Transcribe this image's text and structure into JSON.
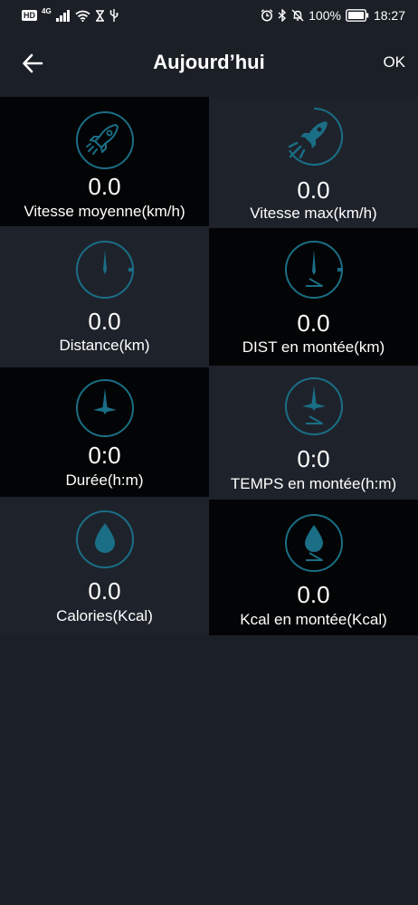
{
  "status_bar": {
    "left_icons": [
      "hd-icon",
      "signal-4g-icon",
      "wifi-icon",
      "hourglass-icon",
      "usb-icon"
    ],
    "hd_label": "HD",
    "network_label": "4G",
    "right_icons": [
      "alarm-icon",
      "bluetooth-icon",
      "bell-off-icon",
      "battery-icon"
    ],
    "battery": "100%",
    "time": "18:27"
  },
  "header": {
    "title": "Aujourd’hui",
    "ok_label": "OK",
    "back_icon": "arrow-left-icon"
  },
  "colors": {
    "background": "#1b2027",
    "tile_dark": "#030405",
    "tile_light": "#1e232b",
    "icon_accent": "#1a6e86"
  },
  "stats": [
    {
      "value": "0.0",
      "label": "Vitesse moyenne(km/h)",
      "icon": "rocket-icon"
    },
    {
      "value": "0.0",
      "label": "Vitesse max(km/h)",
      "icon": "rocket-fast-icon"
    },
    {
      "value": "0.0",
      "label": "Distance(km)",
      "icon": "distance-dial-icon"
    },
    {
      "value": "0.0",
      "label": "DIST en montée(km)",
      "icon": "distance-climb-icon"
    },
    {
      "value": "0:0",
      "label": "Durée(h:m)",
      "icon": "clock-icon"
    },
    {
      "value": "0:0",
      "label": "TEMPS en montée(h:m)",
      "icon": "clock-climb-icon"
    },
    {
      "value": "0.0",
      "label": "Calories(Kcal)",
      "icon": "drop-icon"
    },
    {
      "value": "0.0",
      "label": "Kcal en montée(Kcal)",
      "icon": "drop-climb-icon"
    }
  ]
}
